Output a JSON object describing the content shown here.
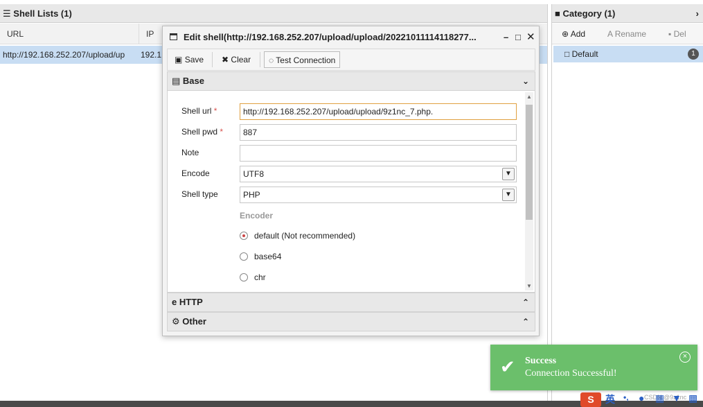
{
  "left_panel": {
    "title": "Shell Lists (1)",
    "columns": [
      "URL",
      "IP"
    ],
    "row": {
      "url": "http://192.168.252.207/upload/up",
      "ip": "192.1"
    }
  },
  "right_panel": {
    "title": "Category (1)",
    "toolbar": {
      "add": "Add",
      "rename": "Rename",
      "del": "Del"
    },
    "category": {
      "name": "Default",
      "count": "1"
    }
  },
  "dialog": {
    "title": "Edit shell(http://192.168.252.207/upload/upload/20221011114118277...",
    "toolbar": {
      "save": "Save",
      "clear": "Clear",
      "test": "Test Connection"
    },
    "sections": {
      "base": "Base",
      "http": "HTTP",
      "other": "Other"
    },
    "form": {
      "shell_url_label": "Shell url",
      "shell_url_value": "http://192.168.252.207/upload/upload/9z1nc_7.php.",
      "shell_pwd_label": "Shell pwd",
      "shell_pwd_value": "887",
      "note_label": "Note",
      "note_value": "",
      "encode_label": "Encode",
      "encode_value": "UTF8",
      "shell_type_label": "Shell type",
      "shell_type_value": "PHP",
      "encoder_heading": "Encoder",
      "encoders": [
        "default (Not recommended)",
        "base64",
        "chr"
      ],
      "required_mark": "*"
    }
  },
  "toast": {
    "title": "Success",
    "message": "Connection Successful!"
  },
  "watermark": "CSDN @9z1nc",
  "ime": {
    "label": "英"
  },
  "colors": {
    "toast_bg": "#6bbf6b",
    "selection": "#c8ddf3",
    "required": "#d9534f"
  }
}
